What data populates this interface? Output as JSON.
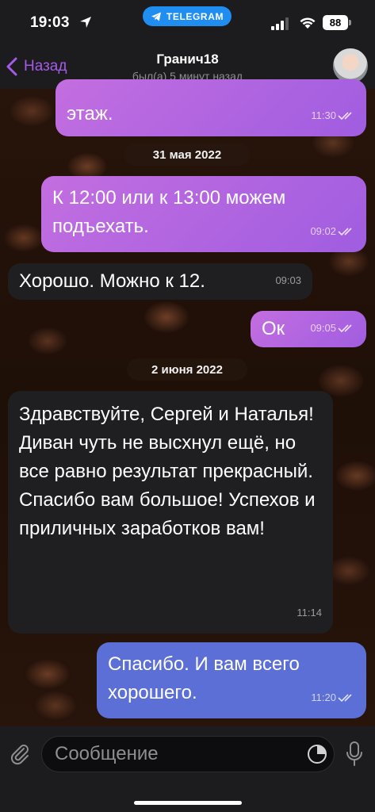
{
  "status_bar": {
    "time": "19:03",
    "app_pill": "TELEGRAM",
    "battery": "88"
  },
  "header": {
    "back_label": "Назад",
    "contact_name": "Гранич18",
    "contact_status": "был(а) 5 минут назад"
  },
  "messages": [
    {
      "type": "outgoing",
      "text": "этаж.",
      "time": "11:30",
      "read": true
    },
    {
      "type": "date",
      "text": "31 мая 2022"
    },
    {
      "type": "outgoing",
      "text": "К 12:00 или к 13:00 можем подъехать.",
      "time": "09:02",
      "read": true
    },
    {
      "type": "incoming",
      "text": "Хорошо. Можно к 12.",
      "time": "09:03"
    },
    {
      "type": "outgoing",
      "text": "Ок",
      "time": "09:05",
      "read": true
    },
    {
      "type": "date",
      "text": "2 июня 2022"
    },
    {
      "type": "incoming",
      "text": "Здравствуйте, Сергей и Наталья! Диван чуть не высхнул ещё, но все равно результат прекрасный. Спасибо вам большое! Успехов и приличных заработков вам!",
      "time": "11:14"
    },
    {
      "type": "outgoing",
      "text": "Спасибо. И вам всего хорошего.",
      "time": "11:20",
      "read": true
    }
  ],
  "composer": {
    "placeholder": "Сообщение"
  },
  "colors": {
    "accent": "#a55be8",
    "outgoing_bubble": "#b466e0",
    "outgoing_bubble_last": "#5b6fd6",
    "incoming_bubble": "#1f1f21"
  }
}
